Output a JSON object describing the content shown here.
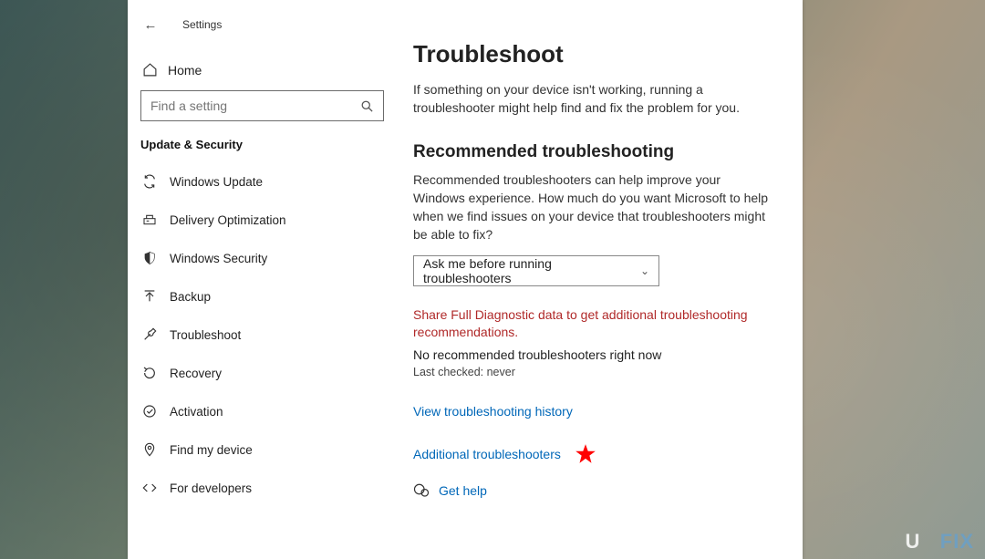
{
  "app": {
    "title": "Settings"
  },
  "sidebar": {
    "home": "Home",
    "search_placeholder": "Find a setting",
    "category": "Update & Security",
    "items": [
      {
        "label": "Windows Update"
      },
      {
        "label": "Delivery Optimization"
      },
      {
        "label": "Windows Security"
      },
      {
        "label": "Backup"
      },
      {
        "label": "Troubleshoot"
      },
      {
        "label": "Recovery"
      },
      {
        "label": "Activation"
      },
      {
        "label": "Find my device"
      },
      {
        "label": "For developers"
      }
    ]
  },
  "main": {
    "title": "Troubleshoot",
    "intro": "If something on your device isn't working, running a troubleshooter might help find and fix the problem for you.",
    "section_title": "Recommended troubleshooting",
    "section_desc": "Recommended troubleshooters can help improve your Windows experience. How much do you want Microsoft to help when we find issues on your device that troubleshooters might be able to fix?",
    "dropdown_value": "Ask me before running troubleshooters",
    "warning_link": "Share Full Diagnostic data to get additional troubleshooting recommendations.",
    "no_recommended": "No recommended troubleshooters right now",
    "last_checked": "Last checked: never",
    "history_link": "View troubleshooting history",
    "additional_link": "Additional troubleshooters",
    "get_help": "Get help"
  },
  "watermark": {
    "left": "U",
    "right": "FIX"
  }
}
